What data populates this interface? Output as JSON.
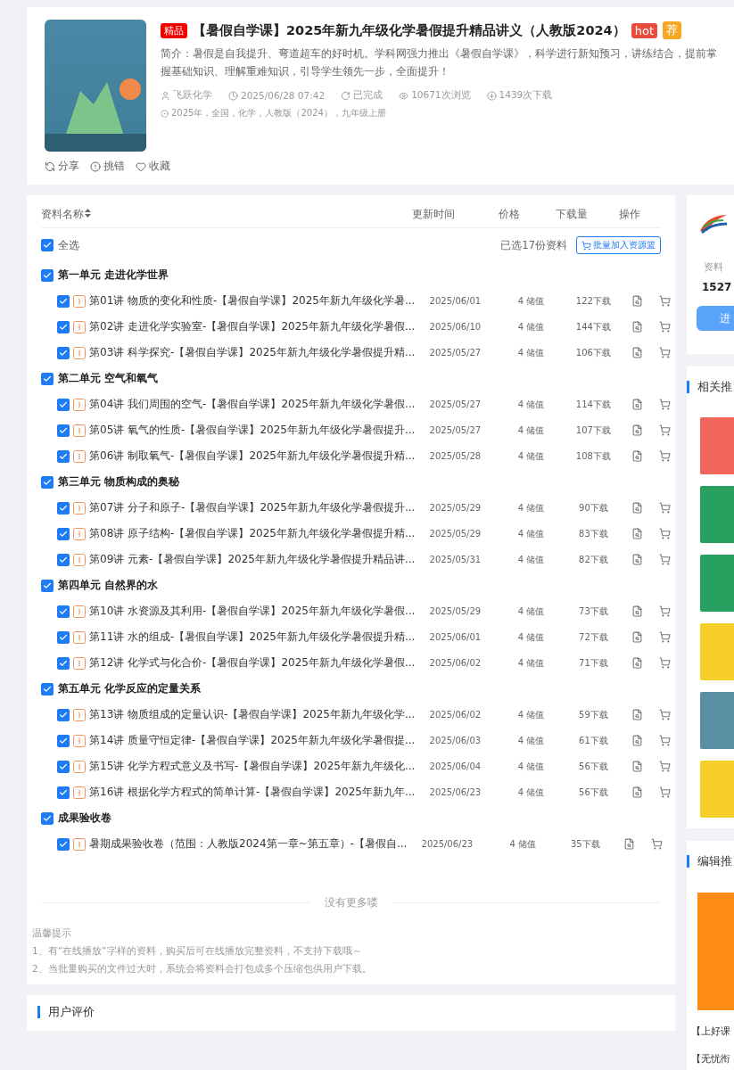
{
  "resource": {
    "badge": "精品",
    "title": "【暑假自学课】2025年新九年级化学暑假提升精品讲义（人教版2024）",
    "hot": "hot",
    "recommended": "荐",
    "intro": "简介：暑假是自我提升、弯道超车的好时机。学科网强力推出《暑假自学课》，科学进行新知预习，讲练结合，提前掌握基础知识、理解重难知识，引导学生领先一步，全面提升！",
    "meta": [
      {
        "kind": "author",
        "text": "飞跃化学"
      },
      {
        "kind": "time",
        "text": "2025/06/28 07:42"
      },
      {
        "kind": "status",
        "text": "已完成"
      },
      {
        "kind": "views",
        "text": "10671次浏览"
      },
      {
        "kind": "downloads",
        "text": "1439次下载"
      }
    ],
    "tags": "2025年，全国，化学，人教版（2024），九年级上册",
    "actions": [
      {
        "kind": "share",
        "label": "分享"
      },
      {
        "kind": "report",
        "label": "挑错"
      },
      {
        "kind": "favorite",
        "label": "收藏"
      }
    ]
  },
  "table": {
    "columns": [
      "资料名称",
      "更新时间",
      "价格",
      "下载量",
      "操作"
    ],
    "select_all": {
      "label": "全选",
      "checked": true
    },
    "selected_count": "已选17份资料",
    "batch_button": "批量加入资源篮",
    "groups": [
      {
        "name": "第一单元 走进化学世界",
        "checked": true,
        "items": [
          {
            "title": "第01讲 物质的变化和性质-【暑假自学课】2025年新九年级化学暑...",
            "date": "2025/06/01",
            "price": "4 储值",
            "downloads": "122下载",
            "checked": true
          },
          {
            "title": "第02讲 走进化学实验室-【暑假自学课】2025年新九年级化学暑假...",
            "date": "2025/06/10",
            "price": "4 储值",
            "downloads": "144下载",
            "checked": true
          },
          {
            "title": "第03讲 科学探究-【暑假自学课】2025年新九年级化学暑假提升精...",
            "date": "2025/05/27",
            "price": "4 储值",
            "downloads": "106下载",
            "checked": true
          }
        ]
      },
      {
        "name": "第二单元 空气和氧气",
        "checked": true,
        "items": [
          {
            "title": "第04讲 我们周围的空气-【暑假自学课】2025年新九年级化学暑假...",
            "date": "2025/05/27",
            "price": "4 储值",
            "downloads": "114下载",
            "checked": true
          },
          {
            "title": "第05讲 氧气的性质-【暑假自学课】2025年新九年级化学暑假提升...",
            "date": "2025/05/27",
            "price": "4 储值",
            "downloads": "107下载",
            "checked": true
          },
          {
            "title": "第06讲 制取氧气-【暑假自学课】2025年新九年级化学暑假提升精...",
            "date": "2025/05/28",
            "price": "4 储值",
            "downloads": "108下载",
            "checked": true
          }
        ]
      },
      {
        "name": "第三单元 物质构成的奥秘",
        "checked": true,
        "items": [
          {
            "title": "第07讲 分子和原子-【暑假自学课】2025年新九年级化学暑假提升...",
            "date": "2025/05/29",
            "price": "4 储值",
            "downloads": "90下载",
            "checked": true
          },
          {
            "title": "第08讲 原子结构-【暑假自学课】2025年新九年级化学暑假提升精...",
            "date": "2025/05/29",
            "price": "4 储值",
            "downloads": "83下载",
            "checked": true
          },
          {
            "title": "第09讲 元素-【暑假自学课】2025年新九年级化学暑假提升精品讲...",
            "date": "2025/05/31",
            "price": "4 储值",
            "downloads": "82下载",
            "checked": true
          }
        ]
      },
      {
        "name": "第四单元 自然界的水",
        "checked": true,
        "items": [
          {
            "title": "第10讲 水资源及其利用-【暑假自学课】2025年新九年级化学暑假...",
            "date": "2025/05/29",
            "price": "4 储值",
            "downloads": "73下载",
            "checked": true
          },
          {
            "title": "第11讲 水的组成-【暑假自学课】2025年新九年级化学暑假提升精...",
            "date": "2025/06/01",
            "price": "4 储值",
            "downloads": "72下载",
            "checked": true
          },
          {
            "title": "第12讲 化学式与化合价-【暑假自学课】2025年新九年级化学暑假...",
            "date": "2025/06/02",
            "price": "4 储值",
            "downloads": "71下载",
            "checked": true
          }
        ]
      },
      {
        "name": "第五单元 化学反应的定量关系",
        "checked": true,
        "items": [
          {
            "title": "第13讲 物质组成的定量认识-【暑假自学课】2025年新九年级化学...",
            "date": "2025/06/02",
            "price": "4 储值",
            "downloads": "59下载",
            "checked": true
          },
          {
            "title": "第14讲 质量守恒定律-【暑假自学课】2025年新九年级化学暑假提...",
            "date": "2025/06/03",
            "price": "4 储值",
            "downloads": "61下载",
            "checked": true
          },
          {
            "title": "第15讲 化学方程式意义及书写-【暑假自学课】2025年新九年级化...",
            "date": "2025/06/04",
            "price": "4 储值",
            "downloads": "56下载",
            "checked": true
          },
          {
            "title": "第16讲 根据化学方程式的简单计算-【暑假自学课】2025年新九年...",
            "date": "2025/06/23",
            "price": "4 储值",
            "downloads": "56下载",
            "checked": true
          }
        ]
      },
      {
        "name": "成果验收卷",
        "checked": true,
        "items": [
          {
            "title": "暑期成果验收卷（范围：人教版2024第一章~第五章）-【暑假自...",
            "date": "2025/06/23",
            "price": "4 储值",
            "downloads": "35下载",
            "checked": true
          }
        ]
      }
    ],
    "end_text": "没有更多喽",
    "tips": {
      "title": "温馨提示",
      "lines": [
        "1、有“在线播放”字样的资料，购买后可在线播放完整资料，不支持下载哦～",
        "2、当批量购买的文件过大时，系统会将资料会打包成多个压缩包供用户下载。"
      ]
    }
  },
  "reviews": {
    "title": "用户评价"
  },
  "sidebar": {
    "author": {
      "stat_label": "资料",
      "stat_value": "1527",
      "button": "进"
    },
    "related": {
      "title": "相关推"
    },
    "editor": {
      "title": "编辑推",
      "items": [
        "【上好课",
        "【无忧衔"
      ]
    }
  }
}
